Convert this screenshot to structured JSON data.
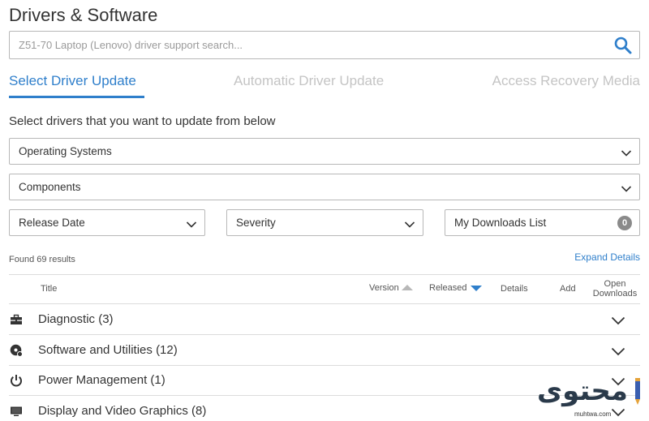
{
  "page_title": "Drivers & Software",
  "search": {
    "placeholder": "Z51-70 Laptop (Lenovo) driver support search...",
    "value": ""
  },
  "tabs": [
    {
      "label": "Select Driver Update",
      "active": true
    },
    {
      "label": "Automatic Driver Update",
      "active": false
    },
    {
      "label": "Access Recovery Media",
      "active": false
    }
  ],
  "instructions": "Select drivers that you want to update from below",
  "filters": {
    "operating_systems": "Operating Systems",
    "components": "Components",
    "release_date": "Release Date",
    "severity": "Severity",
    "my_downloads": "My Downloads List",
    "my_downloads_count": "0"
  },
  "results": {
    "count_text": "Found 69 results",
    "expand_label": "Expand Details"
  },
  "table_headers": {
    "title": "Title",
    "version": "Version",
    "released": "Released",
    "details": "Details",
    "add": "Add",
    "open_line1": "Open",
    "open_line2": "Downloads"
  },
  "categories": [
    {
      "label": "Diagnostic (3)",
      "icon": "toolbox-icon"
    },
    {
      "label": "Software and Utilities (12)",
      "icon": "disc-icon"
    },
    {
      "label": "Power Management (1)",
      "icon": "power-icon"
    },
    {
      "label": "Display and Video Graphics (8)",
      "icon": "monitor-icon"
    }
  ],
  "watermark": {
    "text": "محتوى",
    "url": "muhtwa.com"
  },
  "colors": {
    "accent": "#2f7fcb",
    "border": "#b8b8b8",
    "inactive_tab": "#c4c4c4",
    "text": "#333333"
  }
}
